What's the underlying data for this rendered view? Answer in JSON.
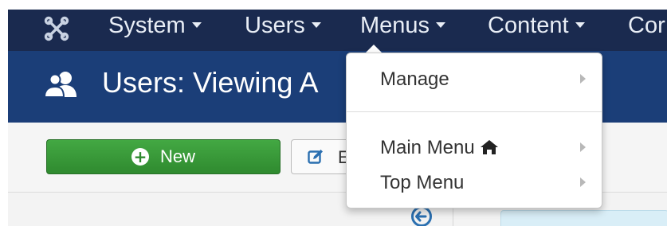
{
  "navbar": {
    "logo_icon": "joomla-logo-icon",
    "items": [
      {
        "label": "System"
      },
      {
        "label": "Users"
      },
      {
        "label": "Menus"
      },
      {
        "label": "Content"
      },
      {
        "label": "Cor"
      }
    ]
  },
  "header": {
    "title": "Users: Viewing A",
    "icon": "users-icon"
  },
  "toolbar": {
    "new_label": "New",
    "edit_label": "E"
  },
  "menus_dropdown": {
    "items": [
      {
        "label": "Manage",
        "has_submenu": true
      },
      {
        "label": "Main Menu",
        "icon": "home-icon",
        "has_submenu": true
      },
      {
        "label": "Top Menu",
        "has_submenu": true
      }
    ]
  },
  "colors": {
    "navbar": "#1a2a4f",
    "titlebar": "#1b3e78",
    "new_button": "#3a9b3a"
  }
}
